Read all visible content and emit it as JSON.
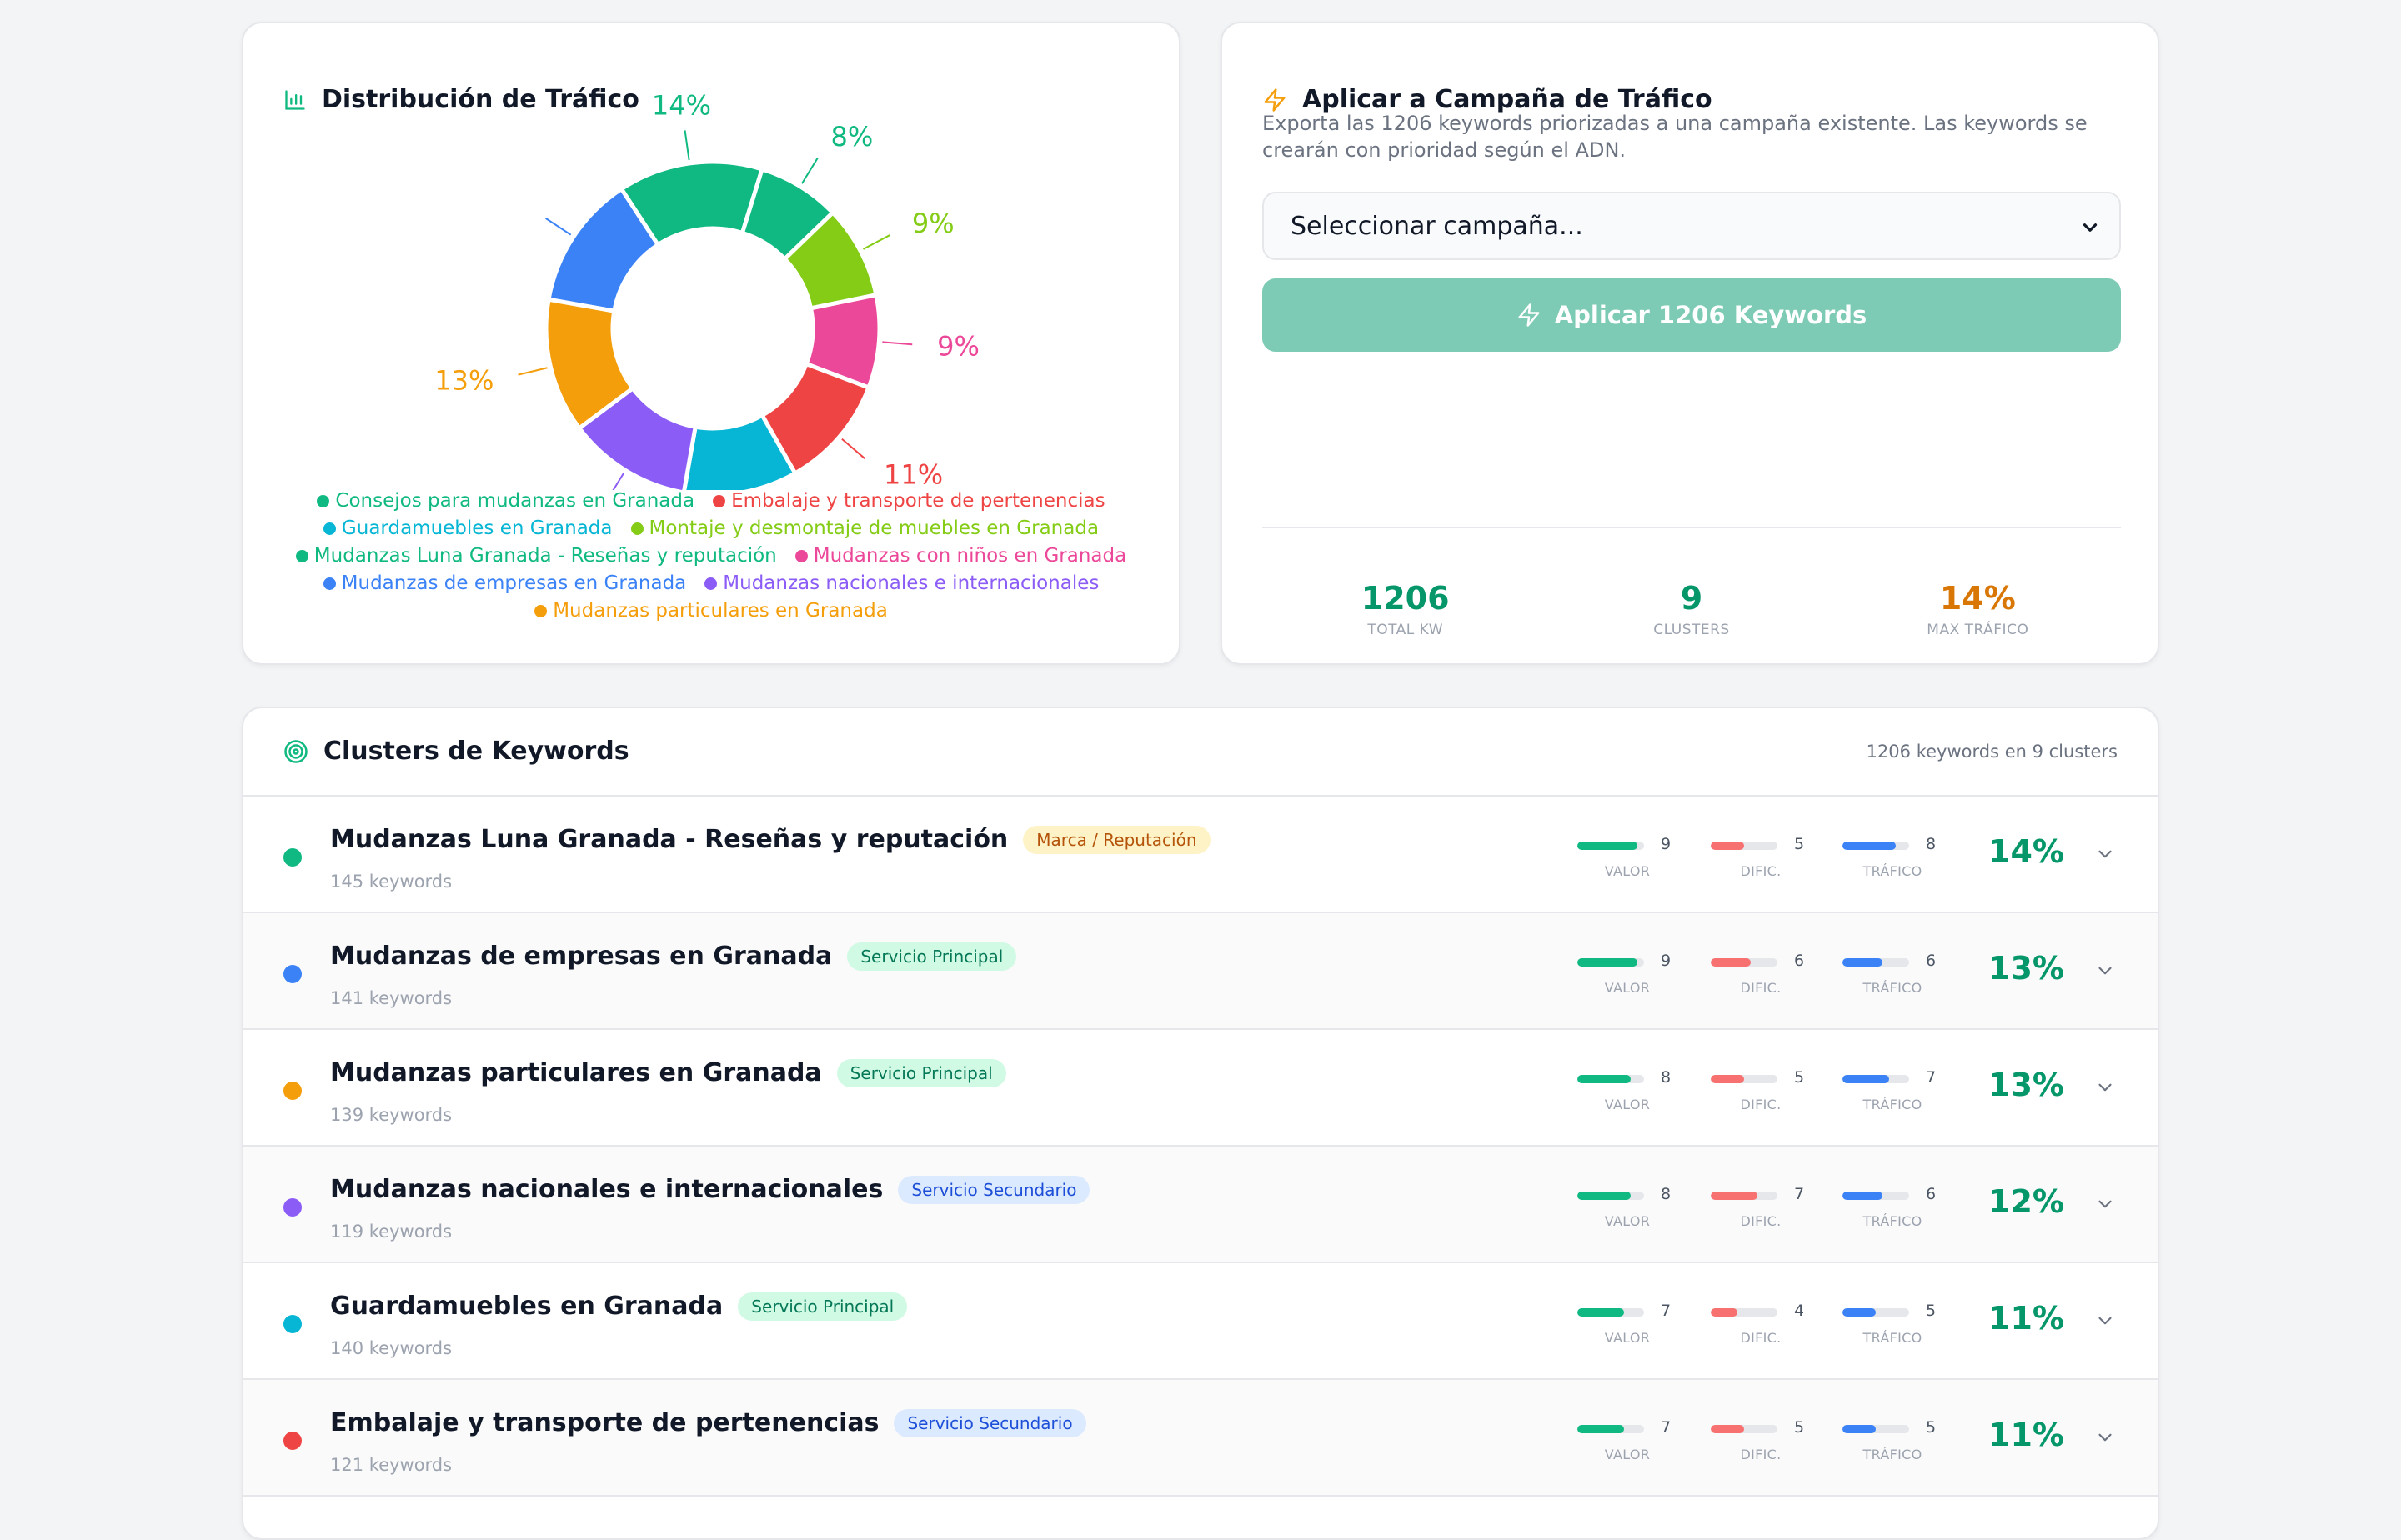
{
  "chart_card": {
    "title": "Distribución de Tráfico"
  },
  "chart_data": {
    "type": "pie",
    "title": "Distribución de Tráfico",
    "donut": true,
    "slices": [
      {
        "name": "Mudanzas de empresas en Granada",
        "value": 13,
        "label": "",
        "color": "#3b82f6"
      },
      {
        "name": "Consejos para mudanzas en Granada",
        "value": 14,
        "label": "14%",
        "color": "#10b981"
      },
      {
        "name": "Mudanzas Luna Granada - Reseñas y reputación",
        "value": 8,
        "label": "8%",
        "color": "#10b981"
      },
      {
        "name": "Montaje y desmontaje de muebles en Granada",
        "value": 9,
        "label": "9%",
        "color": "#84cc16"
      },
      {
        "name": "Mudanzas con niños en Granada",
        "value": 9,
        "label": "9%",
        "color": "#ec4899"
      },
      {
        "name": "Embalaje y transporte de pertenencias",
        "value": 11,
        "label": "11%",
        "color": "#ef4444"
      },
      {
        "name": "Guardamuebles en Granada",
        "value": 11,
        "label": "11%",
        "color": "#06b6d4"
      },
      {
        "name": "Mudanzas nacionales e internacionales",
        "value": 12,
        "label": "12%",
        "color": "#8b5cf6"
      },
      {
        "name": "Mudanzas particulares en Granada",
        "value": 13,
        "label": "13%",
        "color": "#f59e0b"
      }
    ],
    "legend": [
      {
        "label": "Consejos para mudanzas en Granada",
        "color": "#10b981"
      },
      {
        "label": "Embalaje y transporte de pertenencias",
        "color": "#ef4444"
      },
      {
        "label": "Guardamuebles en Granada",
        "color": "#06b6d4"
      },
      {
        "label": "Montaje y desmontaje de muebles en Granada",
        "color": "#84cc16"
      },
      {
        "label": "Mudanzas Luna Granada - Reseñas y reputación",
        "color": "#10b981"
      },
      {
        "label": "Mudanzas con niños en Granada",
        "color": "#ec4899"
      },
      {
        "label": "Mudanzas de empresas en Granada",
        "color": "#3b82f6"
      },
      {
        "label": "Mudanzas nacionales e internacionales",
        "color": "#8b5cf6"
      },
      {
        "label": "Mudanzas particulares en Granada",
        "color": "#f59e0b"
      }
    ],
    "legend_position": "bottom"
  },
  "campaign": {
    "title": "Aplicar a Campaña de Tráfico",
    "description": "Exporta las 1206 keywords priorizadas a una campaña existente. Las keywords se crearán con prioridad según el ADN.",
    "select_value": "Seleccionar campaña...",
    "apply_label": "Aplicar 1206 Keywords",
    "stats": [
      {
        "value": "1206",
        "label": "TOTAL KW",
        "color": "#059669"
      },
      {
        "value": "9",
        "label": "CLUSTERS",
        "color": "#059669"
      },
      {
        "value": "14%",
        "label": "MAX TRÁFICO",
        "color": "#d97706"
      }
    ]
  },
  "clusters": {
    "title": "Clusters de Keywords",
    "count_text": "1206 keywords en 9 clusters",
    "metric_labels": {
      "valor": "VALOR",
      "dific": "DIFIC.",
      "trafico": "TRÁFICO"
    },
    "rows": [
      {
        "name": "Mudanzas Luna Granada - Reseñas y reputación",
        "badge": "Marca / Reputación",
        "badge_type": "marca",
        "keywords": "145 keywords",
        "valor": 9,
        "dific": 5,
        "trafico": 8,
        "pct": "14%",
        "color": "#10b981"
      },
      {
        "name": "Mudanzas de empresas en Granada",
        "badge": "Servicio Principal",
        "badge_type": "principal",
        "keywords": "141 keywords",
        "valor": 9,
        "dific": 6,
        "trafico": 6,
        "pct": "13%",
        "color": "#3b82f6"
      },
      {
        "name": "Mudanzas particulares en Granada",
        "badge": "Servicio Principal",
        "badge_type": "principal",
        "keywords": "139 keywords",
        "valor": 8,
        "dific": 5,
        "trafico": 7,
        "pct": "13%",
        "color": "#f59e0b"
      },
      {
        "name": "Mudanzas nacionales e internacionales",
        "badge": "Servicio Secundario",
        "badge_type": "secundario",
        "keywords": "119 keywords",
        "valor": 8,
        "dific": 7,
        "trafico": 6,
        "pct": "12%",
        "color": "#8b5cf6"
      },
      {
        "name": "Guardamuebles en Granada",
        "badge": "Servicio Principal",
        "badge_type": "principal",
        "keywords": "140 keywords",
        "valor": 7,
        "dific": 4,
        "trafico": 5,
        "pct": "11%",
        "color": "#06b6d4"
      },
      {
        "name": "Embalaje y transporte de pertenencias",
        "badge": "Servicio Secundario",
        "badge_type": "secundario",
        "keywords": "121 keywords",
        "valor": 7,
        "dific": 5,
        "trafico": 5,
        "pct": "11%",
        "color": "#ef4444"
      }
    ]
  },
  "colors": {
    "valor_bar": "#10b981",
    "dific_bar": "#f87171",
    "trafico_bar": "#3b82f6",
    "accent_green": "#059669",
    "accent_orange": "#d97706"
  }
}
